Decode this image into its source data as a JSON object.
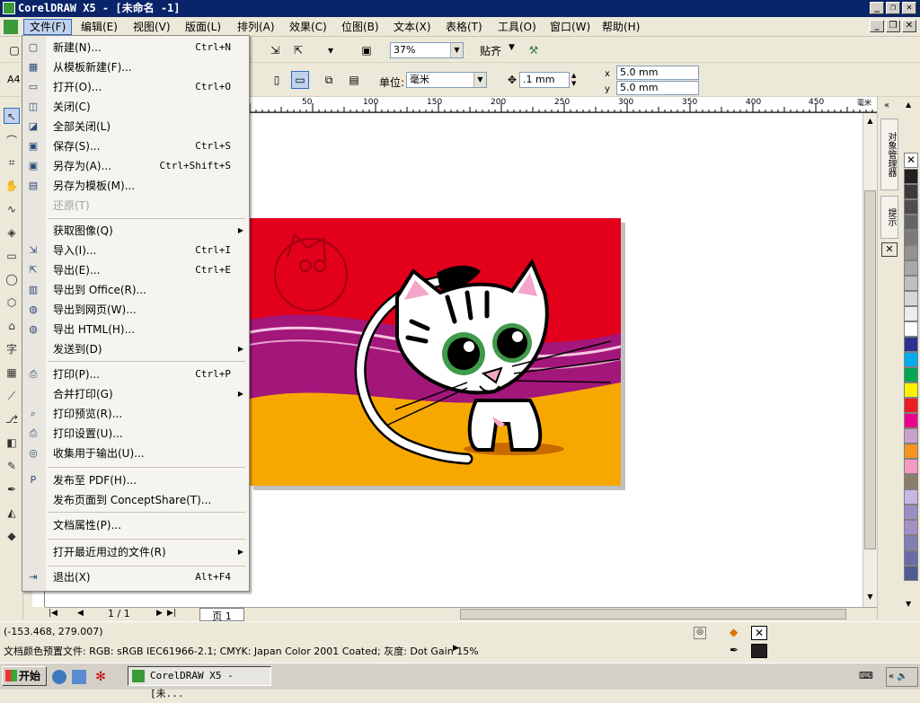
{
  "window": {
    "title": "CorelDRAW X5 - [未命名 -1]"
  },
  "menubar": [
    {
      "label": "文件(F)"
    },
    {
      "label": "编辑(E)"
    },
    {
      "label": "视图(V)"
    },
    {
      "label": "版面(L)"
    },
    {
      "label": "排列(A)"
    },
    {
      "label": "效果(C)"
    },
    {
      "label": "位图(B)"
    },
    {
      "label": "文本(X)"
    },
    {
      "label": "表格(T)"
    },
    {
      "label": "工具(O)"
    },
    {
      "label": "窗口(W)"
    },
    {
      "label": "帮助(H)"
    }
  ],
  "toolbar1": {
    "zoom": "37%",
    "snap": "贴齐"
  },
  "toolbar2": {
    "page_size": "A4",
    "unit_label": "单位:",
    "unit": "毫米",
    "nudge": ".1 mm",
    "dup_x": "5.0 mm",
    "dup_y": "5.0 mm"
  },
  "ruler_labels": [
    "50",
    "100",
    "150",
    "200",
    "250",
    "300",
    "350",
    "400",
    "450",
    "毫米"
  ],
  "file_menu": {
    "items": [
      {
        "label": "新建(N)...",
        "shortcut": "Ctrl+N",
        "icon": "new-icon"
      },
      {
        "label": "从模板新建(F)...",
        "shortcut": "",
        "icon": "template-icon"
      },
      {
        "label": "打开(O)...",
        "shortcut": "Ctrl+O",
        "icon": "open-icon"
      },
      {
        "label": "关闭(C)",
        "shortcut": "",
        "icon": "close-doc-icon"
      },
      {
        "label": "全部关闭(L)",
        "shortcut": "",
        "icon": "close-all-icon"
      },
      {
        "label": "保存(S)...",
        "shortcut": "Ctrl+S",
        "icon": "save-icon"
      },
      {
        "label": "另存为(A)...",
        "shortcut": "Ctrl+Shift+S",
        "icon": "save-as-icon"
      },
      {
        "label": "另存为模板(M)...",
        "shortcut": "",
        "icon": "save-template-icon"
      },
      {
        "label": "还原(T)",
        "shortcut": "",
        "icon": "",
        "disabled": true
      },
      {
        "label": "获取图像(Q)",
        "shortcut": "",
        "icon": "",
        "submenu": true
      },
      {
        "label": "导入(I)...",
        "shortcut": "Ctrl+I",
        "icon": "import-icon"
      },
      {
        "label": "导出(E)...",
        "shortcut": "Ctrl+E",
        "icon": "export-icon"
      },
      {
        "label": "导出到 Office(R)...",
        "shortcut": "",
        "icon": "export-office-icon"
      },
      {
        "label": "导出到网页(W)...",
        "shortcut": "",
        "icon": "export-web-icon"
      },
      {
        "label": "导出 HTML(H)...",
        "shortcut": "",
        "icon": "export-html-icon"
      },
      {
        "label": "发送到(D)",
        "shortcut": "",
        "icon": "",
        "submenu": true
      },
      {
        "label": "打印(P)...",
        "shortcut": "Ctrl+P",
        "icon": "print-icon"
      },
      {
        "label": "合并打印(G)",
        "shortcut": "",
        "icon": "",
        "submenu": true
      },
      {
        "label": "打印预览(R)...",
        "shortcut": "",
        "icon": "print-preview-icon"
      },
      {
        "label": "打印设置(U)...",
        "shortcut": "",
        "icon": "print-setup-icon"
      },
      {
        "label": "收集用于输出(U)...",
        "shortcut": "",
        "icon": "collect-output-icon"
      },
      {
        "label": "发布至 PDF(H)...",
        "shortcut": "",
        "icon": "pdf-icon"
      },
      {
        "label": "发布页面到 ConceptShare(T)...",
        "shortcut": "",
        "icon": ""
      },
      {
        "label": "文档属性(P)...",
        "shortcut": "",
        "icon": ""
      },
      {
        "label": "打开最近用过的文件(R)",
        "shortcut": "",
        "icon": "",
        "submenu": true
      },
      {
        "label": "退出(X)",
        "shortcut": "Alt+F4",
        "icon": "exit-icon"
      }
    ]
  },
  "page_nav": {
    "page_count": "1 / 1",
    "page_tab": "页 1"
  },
  "right_panel": {
    "tab1": "对象管理器",
    "tab2": "提示"
  },
  "status": {
    "coords": "(-153.468, 279.007)",
    "color_profile": "文档颜色预置文件: RGB: sRGB IEC61966-2.1; CMYK: Japan Color 2001 Coated; 灰度: Dot Gain 15%"
  },
  "taskbar": {
    "start": "开始",
    "task": "CorelDRAW X5 - [未..."
  },
  "palette_colors": [
    "#231f20",
    "#3b3b3b",
    "#4d4d4d",
    "#636363",
    "#7a7a7a",
    "#929292",
    "#a8a8a8",
    "#bfbfbf",
    "#d6d6d6",
    "#ececec",
    "#ffffff",
    "#2e3192",
    "#00aeef",
    "#00a651",
    "#fff200",
    "#ed1c24",
    "#ec008c",
    "#c8a2c8",
    "#f7941d",
    "#f49ac1",
    "#8b7d6b",
    "#c7b7e2",
    "#9b8ec4",
    "#a58fc7",
    "#8080b0",
    "#6b6ba8",
    "#4f5b93"
  ]
}
